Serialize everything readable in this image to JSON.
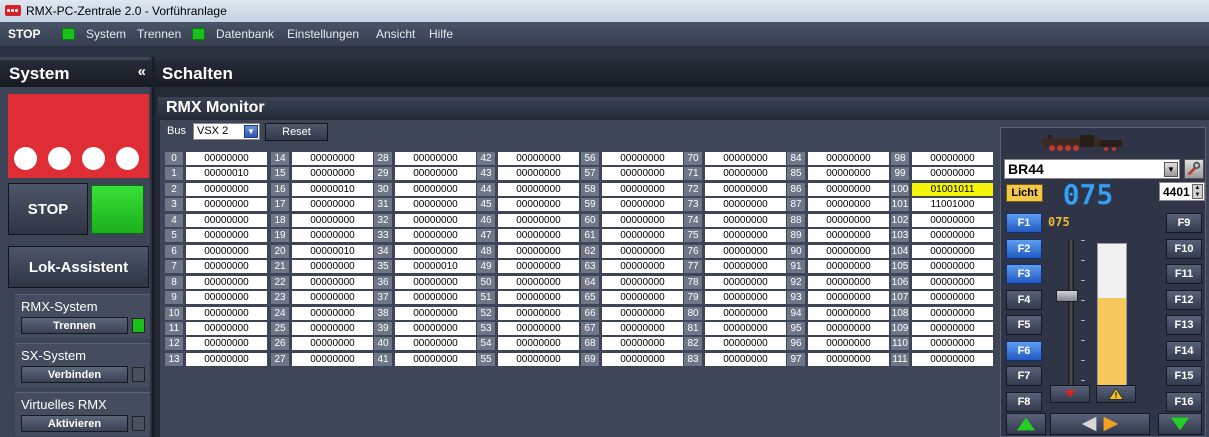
{
  "window": {
    "title": "RMX-PC-Zentrale 2.0 - Vorführanlage"
  },
  "menu": {
    "stop": "STOP",
    "system": "System",
    "trennen": "Trennen",
    "datenbank": "Datenbank",
    "einstellungen": "Einstellungen",
    "ansicht": "Ansicht",
    "hilfe": "Hilfe",
    "led_color": "#19c219"
  },
  "sidebar": {
    "title": "System",
    "collapse": "«",
    "stop_label": "STOP",
    "lok_assistent": "Lok-Assistent",
    "groups": [
      {
        "label": "RMX-System",
        "button": "Trennen",
        "led": "#19c219"
      },
      {
        "label": "SX-System",
        "button": "Verbinden",
        "led": "#4a505e"
      },
      {
        "label": "Virtuelles RMX",
        "button": "Aktivieren",
        "led": "#4a505e"
      }
    ]
  },
  "section": {
    "title": "Schalten"
  },
  "monitor": {
    "title": "RMX Monitor",
    "bus_label": "Bus",
    "bus_value": "VSX 2",
    "reset": "Reset",
    "columns": [
      [
        "00000000",
        "00000010",
        "00000000",
        "00000000",
        "00000000",
        "00000000",
        "00000000",
        "00000000",
        "00000000",
        "00000000",
        "00000000",
        "00000000",
        "00000000",
        "00000000"
      ],
      [
        "00000000",
        "00000000",
        "00000010",
        "00000000",
        "00000000",
        "00000000",
        "00000010",
        "00000000",
        "00000000",
        "00000000",
        "00000000",
        "00000000",
        "00000000",
        "00000000"
      ],
      [
        "00000000",
        "00000000",
        "00000000",
        "00000000",
        "00000000",
        "00000000",
        "00000000",
        "00000010",
        "00000000",
        "00000000",
        "00000000",
        "00000000",
        "00000000",
        "00000000"
      ],
      [
        "00000000",
        "00000000",
        "00000000",
        "00000000",
        "00000000",
        "00000000",
        "00000000",
        "00000000",
        "00000000",
        "00000000",
        "00000000",
        "00000000",
        "00000000",
        "00000000"
      ],
      [
        "00000000",
        "00000000",
        "00000000",
        "00000000",
        "00000000",
        "00000000",
        "00000000",
        "00000000",
        "00000000",
        "00000000",
        "00000000",
        "00000000",
        "00000000",
        "00000000"
      ],
      [
        "00000000",
        "00000000",
        "00000000",
        "00000000",
        "00000000",
        "00000000",
        "00000000",
        "00000000",
        "00000000",
        "00000000",
        "00000000",
        "00000000",
        "00000000",
        "00000000"
      ],
      [
        "00000000",
        "00000000",
        "00000000",
        "00000000",
        "00000000",
        "00000000",
        "00000000",
        "00000000",
        "00000000",
        "00000000",
        "00000000",
        "00000000",
        "00000000",
        "00000000"
      ],
      [
        "00000000",
        "00000000",
        "01001011",
        "11001000",
        "00000000",
        "00000000",
        "00000000",
        "00000000",
        "00000000",
        "00000000",
        "00000000",
        "00000000",
        "00000000",
        "00000000"
      ]
    ],
    "highlight": {
      "col": 7,
      "row": 2,
      "color": "#f5f50a"
    }
  },
  "lok": {
    "name": "BR44",
    "licht": "Licht",
    "speed_display": "075",
    "speed_small": "075",
    "address": "4401",
    "speed_fraction": 0.65,
    "f_left": [
      "F1",
      "F2",
      "F3",
      "F4",
      "F5",
      "F6",
      "F7",
      "F8"
    ],
    "f_right": [
      "F9",
      "F10",
      "F11",
      "F12",
      "F13",
      "F14",
      "F15",
      "F16"
    ],
    "f_active": [
      "F1",
      "F2",
      "F3",
      "F6"
    ],
    "digit_color": "#3aa0f0",
    "small_digit_color": "#f2b93b"
  }
}
